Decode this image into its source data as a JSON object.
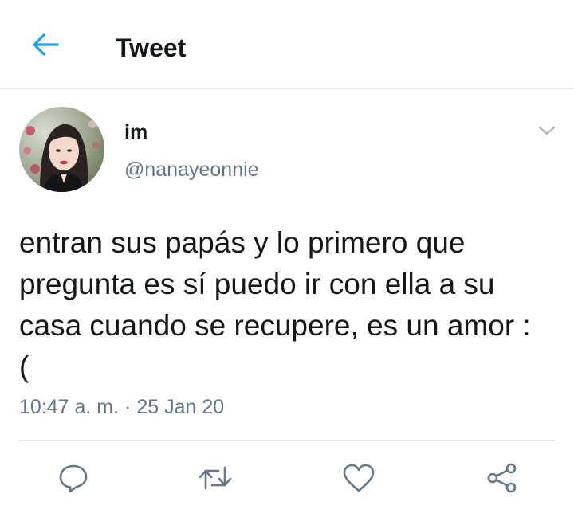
{
  "header": {
    "title": "Tweet",
    "back_icon": "arrow-left-icon",
    "accent": "#1da1f2"
  },
  "tweet": {
    "author": {
      "display_name": "im",
      "handle": "@nanayeonnie",
      "avatar_icon": "profile-photo"
    },
    "text": "entran sus papás y lo primero que pregunta es sí puedo ir con ella a su casa cuando se recupere, es un amor :(",
    "time": "10:47 a. m.",
    "separator": "·",
    "date": "25 Jan 20"
  },
  "actions": [
    {
      "icon": "reply-icon"
    },
    {
      "icon": "retweet-icon"
    },
    {
      "icon": "like-icon"
    },
    {
      "icon": "share-icon"
    }
  ],
  "colors": {
    "text": "#14171a",
    "secondary": "#657786",
    "border": "#e1e8ed"
  }
}
